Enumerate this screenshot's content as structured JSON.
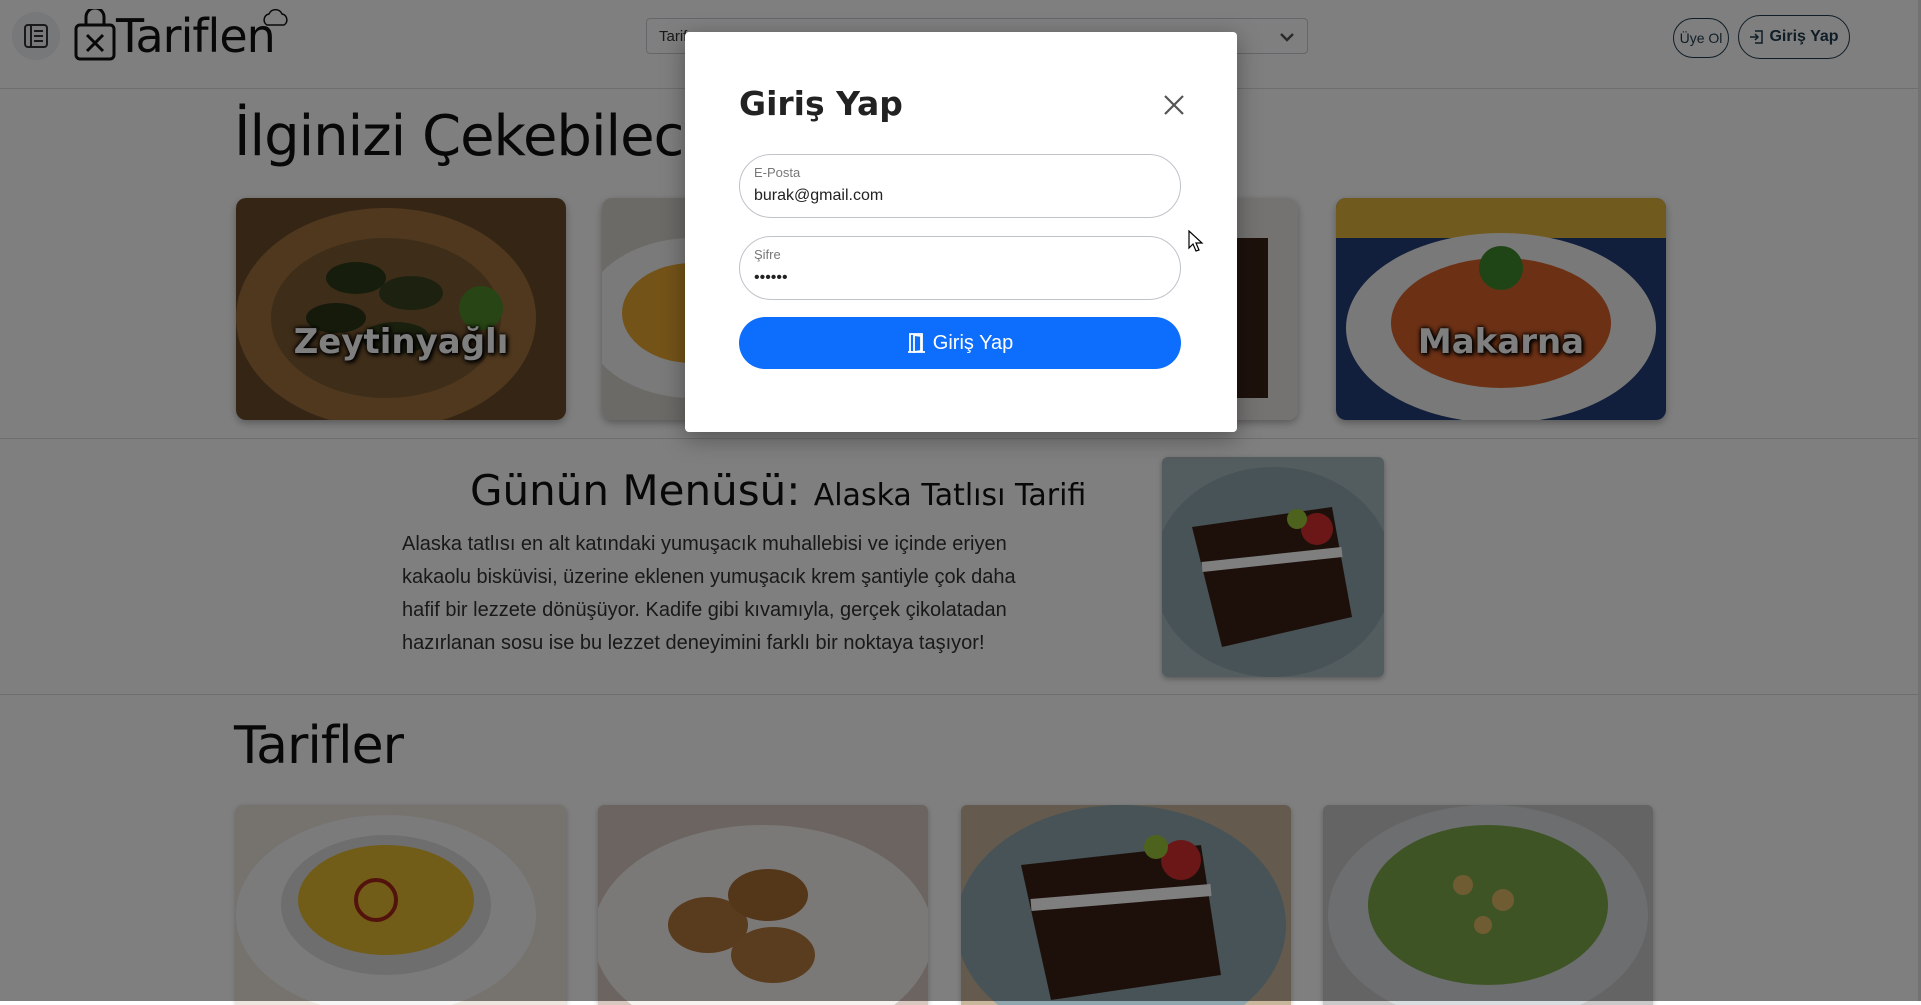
{
  "header": {
    "logo_text": "Tariflen",
    "search_value": "Tarif ara",
    "signup_label": "Üye Ol",
    "login_label": "Giriş Yap"
  },
  "categories": {
    "title": "İlginizi Çekebilecek Kategoriler",
    "items": [
      {
        "label": "Zeytinyağlı",
        "image": "stuffed-grape-leaves"
      },
      {
        "label": "",
        "image": "soup-bowl"
      },
      {
        "label": "",
        "image": "dessert"
      },
      {
        "label": "Makarna",
        "image": "spaghetti-plate"
      }
    ]
  },
  "menu_of_day": {
    "heading": "Günün Menüsü:",
    "dish": "Alaska Tatlısı Tarifi",
    "description": "Alaska tatlısı en alt katındaki yumuşacık muhallebisi ve içinde eriyen kakaolu bisküvisi, üzerine eklenen yumuşacık krem şantiyle çok daha hafif bir lezzete dönüşüyor. Kadife gibi kıvamıyla, gerçek çikolatadan hazırlanan sosu ise bu lezzet deneyimini farklı bir noktaya taşıyor!",
    "image": "chocolate-cake-slice"
  },
  "recipes": {
    "title": "Tarifler",
    "items": [
      {
        "image": "lentil-soup"
      },
      {
        "image": "kofte-dessert"
      },
      {
        "image": "chocolate-cake-slice"
      },
      {
        "image": "caesar-salad"
      }
    ]
  },
  "modal": {
    "title": "Giriş Yap",
    "email_label": "E-Posta",
    "email_value": "burak@gmail.com",
    "password_label": "Şifre",
    "password_value": "••••••",
    "submit_label": "Giriş Yap"
  },
  "colors": {
    "primary": "#0d6efd",
    "header_border": "#1f3b4d",
    "overlay": "rgba(0,0,0,0.5)"
  }
}
